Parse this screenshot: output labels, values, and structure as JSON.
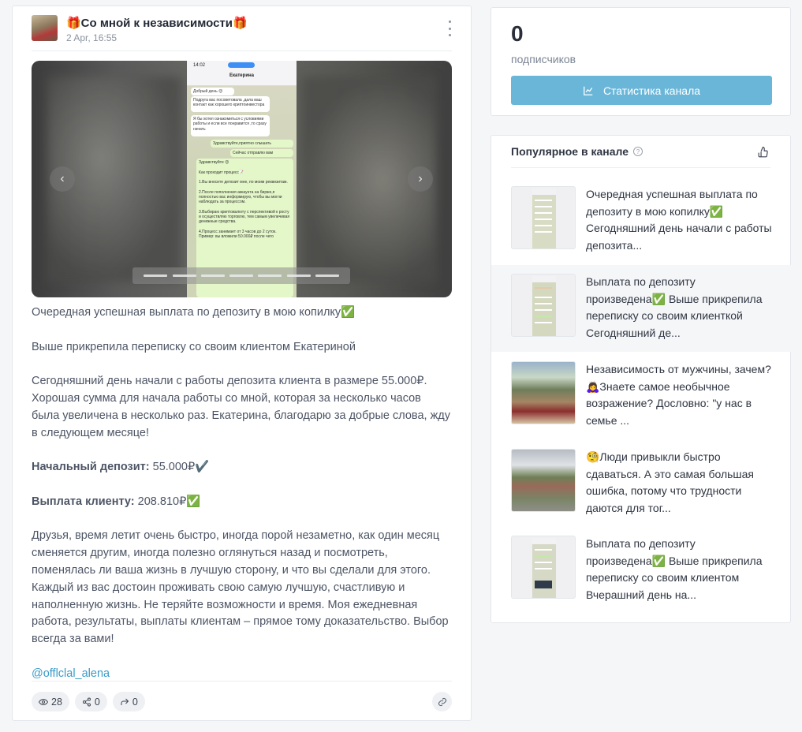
{
  "post": {
    "channel_title": "🎁Со мной к независимости🎁",
    "date": "2 Apr, 16:55",
    "media": {
      "phone_time": "14:02",
      "phone_contact": "Екатерина",
      "bubbles": [
        "Добрый день 😊",
        "Подруга вас посоветовала ,дала ваш контакт как хорошего криптоинвестора",
        "Я бы хотел ознакомиться с условиями работы и если все понравится ,то сразу начать",
        "Здравствуйте,приятно слышать",
        "Сейчас отправлю вам",
        "Здравствуйте 😊",
        "Как проходит процесс📝",
        "1.Вы вносите депозит мне, по моим реквизитам.",
        "2.После пополнения аккаунта на бирже,я полностью вас информирую, чтобы вы могли наблюдать за процессом.",
        "3.Выбираю криптовалюту с перспективой к росту и осуществляю торговлю, тем самым увеличивая денежные средства.",
        "4.Процесс занимает от 3 часов до 2 суток.",
        "Пример: вы вложили 50.000₽ после чего"
      ]
    },
    "paragraph_1": "Очередная успешная выплата по депозиту в мою копилку✅",
    "paragraph_2": "Выше прикрепила переписку со своим клиентом Екатериной",
    "paragraph_3": "Сегодняшний день начали с работы депозита клиента в размере 55.000₽. Хорошая сумма для начала работы со мной, которая за несколько часов была увеличена в несколько раз. Екатерина, благодарю за добрые слова, жду в следующем месяце!",
    "deposit_label": "Начальный депозит:",
    "deposit_value": " 55.000₽✔️",
    "payout_label": "Выплата клиенту:",
    "payout_value": " 208.810₽✅",
    "paragraph_6": "Друзья, время летит очень быстро, иногда порой незаметно, как один месяц сменяется другим, иногда полезно оглянуться назад и посмотреть, поменялась ли ваша жизнь в лучшую сторону, и что вы сделали для этого. Каждый из вас достоин проживать свою самую лучшую, счастливую и наполненную жизнь. Не теряйте возможности и время. Моя ежедневная работа, результаты, выплаты клиентам – прямое тому доказательство. Выбор всегда за вами!",
    "link": "@offlclal_alena",
    "views": "28",
    "shares": "0",
    "forwards": "0"
  },
  "subscribers": {
    "count": "0",
    "label": "подписчиков",
    "stats_button": "Статистика канала"
  },
  "popular": {
    "title": "Популярное в канале",
    "items": [
      {
        "text": "Очередная успешная выплата по депозиту в мою копилку✅ Сегодняшний день начали с работы депозита..."
      },
      {
        "text": "Выплата по депозиту произведена✅ Выше прикрепила переписку со своим клиенткой Сегодняшний де..."
      },
      {
        "text": "Независимость от мужчины, зачем?🙇‍♀️Знаете самое необычное возражение? Дословно: \"у нас в семье ..."
      },
      {
        "text": "🧐Люди привыкли быстро сдаваться. А это самая большая ошибка, потому что трудности даются для тог..."
      },
      {
        "text": "Выплата по депозиту произведена✅ Выше прикрепила переписку со своим клиентом Вчерашний день на..."
      }
    ]
  },
  "colors": {
    "accent_button": "#6ab6d9",
    "link": "#3a9bc8",
    "page_bg": "#f5f6f8"
  }
}
